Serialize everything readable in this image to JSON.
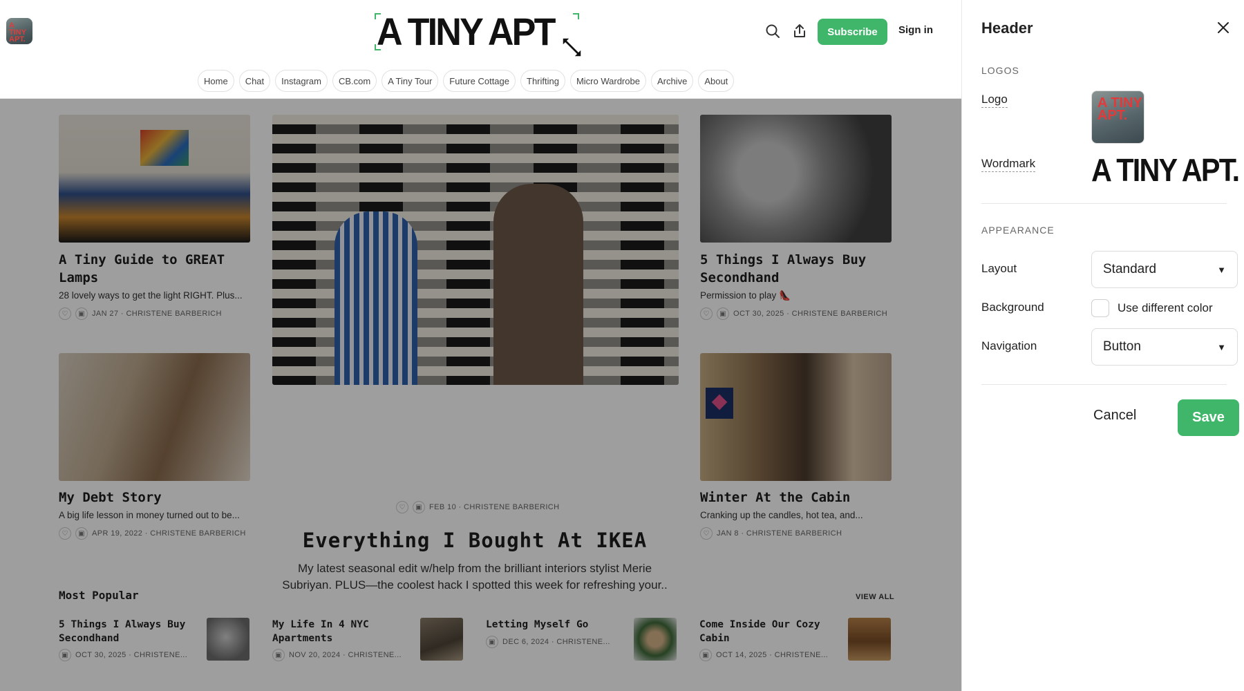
{
  "site": {
    "wordmark": "A TINY APT",
    "logo_text": "A TINY APT.",
    "subscribe_label": "Subscribe",
    "signin_label": "Sign in",
    "nav": [
      "Home",
      "Chat",
      "Instagram",
      "CB.com",
      "A Tiny Tour",
      "Future Cottage",
      "Thrifting",
      "Micro Wardrobe",
      "Archive",
      "About"
    ],
    "posts": [
      {
        "title": "A Tiny Guide to GREAT Lamps",
        "subtitle": "28 lovely ways to get the light RIGHT. Plus...",
        "meta": "JAN 27 · CHRISTENE BARBERICH"
      },
      {
        "title": "5 Things I Always Buy Secondhand",
        "subtitle": "Permission to play 👠",
        "meta": "OCT 30, 2025 · CHRISTENE BARBERICH"
      },
      {
        "title": "My Debt Story",
        "subtitle": "A big life lesson in money turned out to be...",
        "meta": "APR 19, 2022 · CHRISTENE BARBERICH"
      },
      {
        "title": "Winter At the Cabin",
        "subtitle": "Cranking up the candles, hot tea, and...",
        "meta": "JAN 8 · CHRISTENE BARBERICH"
      }
    ],
    "feature": {
      "title": "Everything I Bought At IKEA",
      "subtitle": "My latest seasonal edit w/help from the brilliant interiors stylist Merie Subriyan. PLUS—the coolest hack I spotted this week for refreshing your..",
      "meta": "FEB 10 · CHRISTENE BARBERICH"
    },
    "popular": {
      "heading": "Most Popular",
      "view_all": "VIEW ALL",
      "items": [
        {
          "title": "5 Things I Always Buy Secondhand",
          "meta": "OCT 30, 2025 · CHRISTENE..."
        },
        {
          "title": "My Life In 4 NYC Apartments",
          "meta": "NOV 20, 2024 · CHRISTENE..."
        },
        {
          "title": "Letting Myself Go",
          "meta": "DEC 6, 2024 · CHRISTENE..."
        },
        {
          "title": "Come Inside Our Cozy Cabin",
          "meta": "OCT 14, 2025 · CHRISTENE..."
        }
      ]
    }
  },
  "panel": {
    "title": "Header",
    "logos_section": "LOGOS",
    "logo_label": "Logo",
    "wordmark_label": "Wordmark",
    "wordmark_text": "A TINY APT.",
    "appearance_section": "APPEARANCE",
    "layout_label": "Layout",
    "layout_value": "Standard",
    "background_label": "Background",
    "background_checkbox_label": "Use different color",
    "navigation_label": "Navigation",
    "navigation_value": "Button",
    "cancel_label": "Cancel",
    "save_label": "Save"
  },
  "colors": {
    "accent": "#3fb66a",
    "overlay": "rgba(0,0,0,0.38)"
  }
}
